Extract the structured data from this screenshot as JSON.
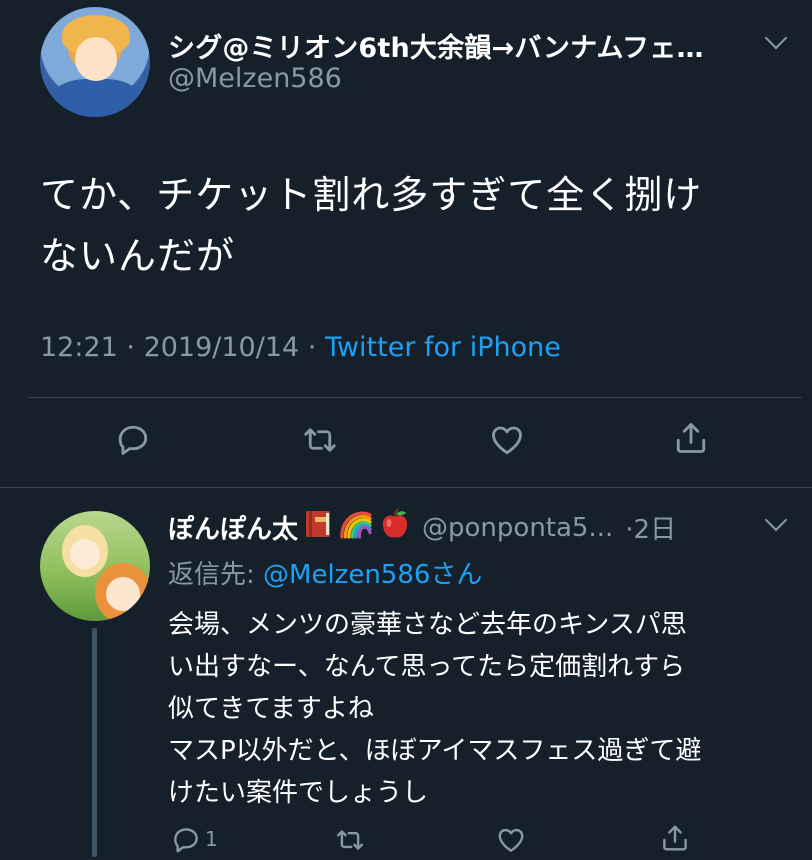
{
  "main_tweet": {
    "display_name": "シグ@ミリオン6th大余韻→バンナムフェ…",
    "handle": "@Melzen586",
    "text_lines": [
      "てか、チケット割れ多すぎて全く捌け",
      "ないんだが"
    ],
    "time": "12:21",
    "date": "2019/10/14",
    "via": "Twitter for iPhone",
    "separator": " · "
  },
  "reply_tweet": {
    "display_name": "ぽんぽん太",
    "emoji": [
      "book-icon",
      "rainbow-icon",
      "apple-icon"
    ],
    "handle": "@ponponta5...",
    "age": "·2日",
    "reply_to_label": "返信先: ",
    "reply_to_mention": "@Melzen586さん",
    "text_lines": [
      "会場、メンツの豪華さなど去年のキンスパ思",
      "い出すなー、なんて思ってたら定価割れすら",
      "似てきてますよね",
      "マスP以外だと、ほぼアイマスフェス過ぎて避",
      "けたい案件でしょうし"
    ],
    "reply_count": "1"
  },
  "colors": {
    "background": "#15202b",
    "text": "#ffffff",
    "secondary": "#8899a6",
    "accent": "#1da1f2",
    "divider": "#38444d"
  }
}
